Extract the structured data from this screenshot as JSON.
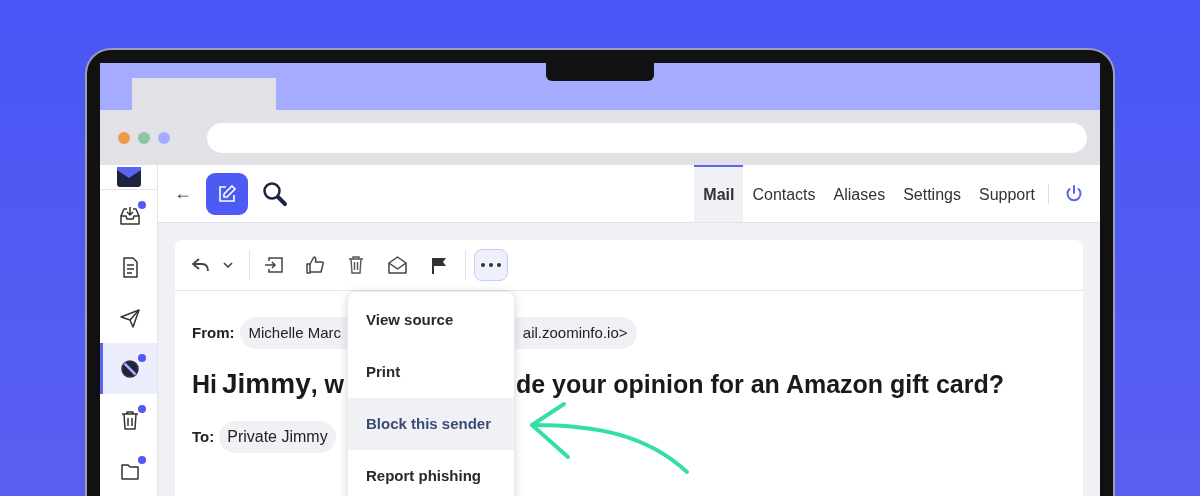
{
  "sidebar": {
    "items": [
      {
        "kind": "inbox",
        "unread": true,
        "selected": false
      },
      {
        "kind": "drafts",
        "unread": false,
        "selected": false
      },
      {
        "kind": "sent",
        "unread": false,
        "selected": false
      },
      {
        "kind": "blocked",
        "unread": true,
        "selected": true
      },
      {
        "kind": "trash",
        "unread": true,
        "selected": false
      },
      {
        "kind": "folder",
        "unread": true,
        "selected": false
      }
    ]
  },
  "header": {
    "back": "←",
    "nav": [
      {
        "label": "Mail",
        "selected": true
      },
      {
        "label": "Contacts",
        "selected": false
      },
      {
        "label": "Aliases",
        "selected": false
      },
      {
        "label": "Settings",
        "selected": false
      },
      {
        "label": "Support",
        "selected": false
      }
    ]
  },
  "toolbar": {
    "more_expanded": true
  },
  "message": {
    "from_label": "From:",
    "from_visible_start": "Michelle Marc",
    "from_visible_end": "ail.zoominfo.io>",
    "subject_greeting": "Hi",
    "subject_name": "Jimmy",
    "subject_visible_start": ", w",
    "subject_visible_end": "de your opinion for an Amazon gift card?",
    "to_label": "To:",
    "to": "Private Jimmy"
  },
  "menu": {
    "items": [
      {
        "label": "View source",
        "selected": false
      },
      {
        "label": "Print",
        "selected": false
      },
      {
        "label": "Block this sender",
        "selected": true
      },
      {
        "label": "Report phishing",
        "selected": false
      }
    ]
  }
}
